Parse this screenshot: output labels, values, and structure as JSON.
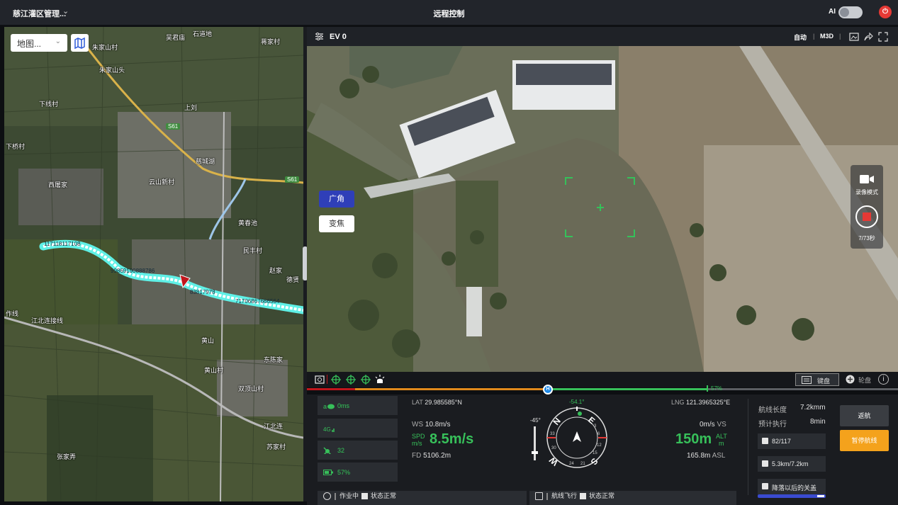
{
  "topbar": {
    "org_name": "慈江灌区管理...",
    "title": "远程控制",
    "ai_label": "AI"
  },
  "map": {
    "layer_select": "地图...",
    "labels": [
      {
        "text": "吴君庙"
      },
      {
        "text": "石道地"
      },
      {
        "text": "蒋家村"
      },
      {
        "text": "朱家山村"
      },
      {
        "text": "朱家山头"
      },
      {
        "text": "下线村"
      },
      {
        "text": "上刘"
      },
      {
        "text": "西屠家"
      },
      {
        "text": "云山新村"
      },
      {
        "text": "慈城湖"
      },
      {
        "text": "黄春池"
      },
      {
        "text": "民丰村"
      },
      {
        "text": "赵家"
      },
      {
        "text": "德贤"
      },
      {
        "text": "江北连接线"
      },
      {
        "text": "作线"
      },
      {
        "text": "黄山"
      },
      {
        "text": "东陈家"
      },
      {
        "text": "黄山村"
      },
      {
        "text": "双顶山村"
      },
      {
        "text": "苏家村"
      },
      {
        "text": "张家弄"
      },
      {
        "text": "江北连"
      },
      {
        "text": "下桥村"
      }
    ],
    "road_badges": [
      "S61",
      "S61"
    ],
    "route_labels": [
      "117118117108",
      "99869190888786",
      "83817978",
      "71706867666564"
    ]
  },
  "video": {
    "ev_label": "EV 0",
    "mode_auto": "自动",
    "mode_m3d": "M3D",
    "lens_wide": "广角",
    "lens_zoom": "变焦",
    "record_mode": "录像模式",
    "record_time": "7/73秒"
  },
  "toolbar": {
    "keyboard": "键盘",
    "remote": "轮盘",
    "info": "i"
  },
  "progress": {
    "h_label": "H",
    "percent_label": "57%",
    "fraction": 0.57
  },
  "status_left": [
    {
      "icon": "cloud-icon",
      "value": "0ms"
    },
    {
      "icon": "signal-4g-icon",
      "value": ""
    },
    {
      "icon": "satellite-icon",
      "value": "32"
    },
    {
      "icon": "battery-icon",
      "value": "57%"
    }
  ],
  "telemetry": {
    "lat_label": "LAT",
    "lat_value": "29.985585°N",
    "lng_label": "LNG",
    "lng_value": "121.3965325°E",
    "ws_label": "WS",
    "ws_value": "10.8m/s",
    "spd_label": "SPD",
    "spd_unit": "m/s",
    "spd_value": "8.5m/s",
    "fd_label": "FD",
    "fd_value": "5106.2m",
    "vs_value": "0m/s",
    "vs_label": "VS",
    "alt_value": "150m",
    "alt_label": "ALT",
    "alt_unit": "m",
    "asl_value": "165.8m",
    "asl_label": "ASL",
    "gimbal_pitch": "-45°",
    "heading": "-54.1°",
    "compass": {
      "n": "N",
      "e": "E",
      "s": "S",
      "w": "W",
      "t3": "3",
      "t6": "6",
      "t12": "12",
      "t15": "15",
      "t21": "21",
      "t24": "24",
      "t30": "30",
      "t33": "33"
    }
  },
  "route_info": {
    "length_label": "航线长度",
    "length_value": "7.2kmm",
    "time_label": "预计执行",
    "time_value": "8min",
    "waypoints": "82/117",
    "distance": "5.3km/7.2km",
    "after_landing": "降落以后的关盖"
  },
  "actions": {
    "return": "返航",
    "pause": "暂停航线"
  },
  "statusbar": {
    "job_state": "作业中",
    "job_status": "状态正常",
    "flight_state": "航线飞行",
    "flight_status": "状态正常"
  },
  "colors": {
    "accent_green": "#37c05a",
    "pause_orange": "#f4a21c",
    "power_red": "#e53935",
    "lens_active": "#2f3fb8",
    "route_cyan": "#5ff0e6"
  }
}
